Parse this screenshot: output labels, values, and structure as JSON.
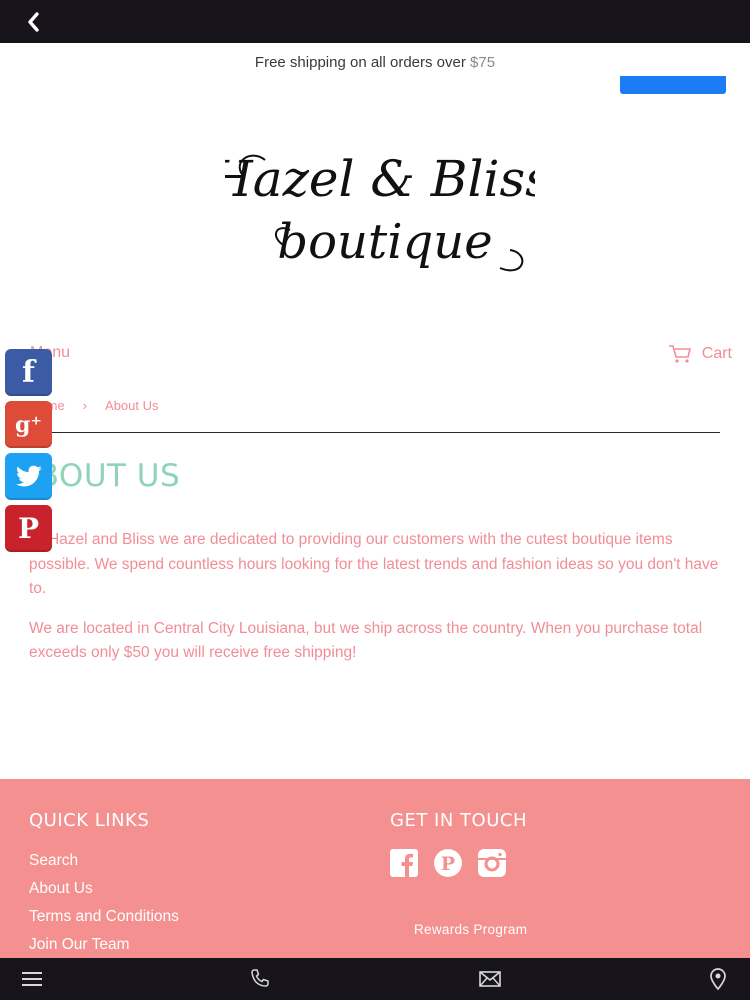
{
  "announcement": {
    "text": "Free shipping on all orders over ",
    "amount": "$75"
  },
  "brand": {
    "line1": "Hazel & Bliss",
    "line2": "boutique"
  },
  "nav": {
    "menu_label": "Menu",
    "cart_label": "Cart"
  },
  "breadcrumb": {
    "home": "Home",
    "separator": "›",
    "current": "About Us"
  },
  "page": {
    "title": "ABOUT US",
    "paragraphs": [
      "At Hazel and Bliss we are dedicated to providing our customers with the cutest boutique items possible. We spend countless hours looking for the latest trends and fashion ideas so you don't have to.",
      "We are located in Central City Louisiana, but we ship across the country. When you purchase total exceeds only $50 you will receive free shipping!"
    ]
  },
  "social_rail": [
    "facebook-icon",
    "google-plus-icon",
    "twitter-icon",
    "pinterest-icon"
  ],
  "footer": {
    "quick_links_title": "QUICK LINKS",
    "quick_links": [
      "Search",
      "About Us",
      "Terms and Conditions",
      "Join Our Team"
    ],
    "get_in_touch_title": "GET IN TOUCH",
    "social_icons": [
      "facebook-icon",
      "pinterest-icon",
      "instagram-icon"
    ],
    "rewards_label": "Rewards Program"
  },
  "bottom_bar": [
    "menu-icon",
    "phone-icon",
    "mail-icon",
    "location-icon"
  ],
  "colors": {
    "accent_pink": "#f28d96",
    "title_mint": "#8fd3ba",
    "footer_bg": "#f4908f",
    "bar_dark": "#17151b",
    "messenger_blue": "#1b7cf3"
  }
}
